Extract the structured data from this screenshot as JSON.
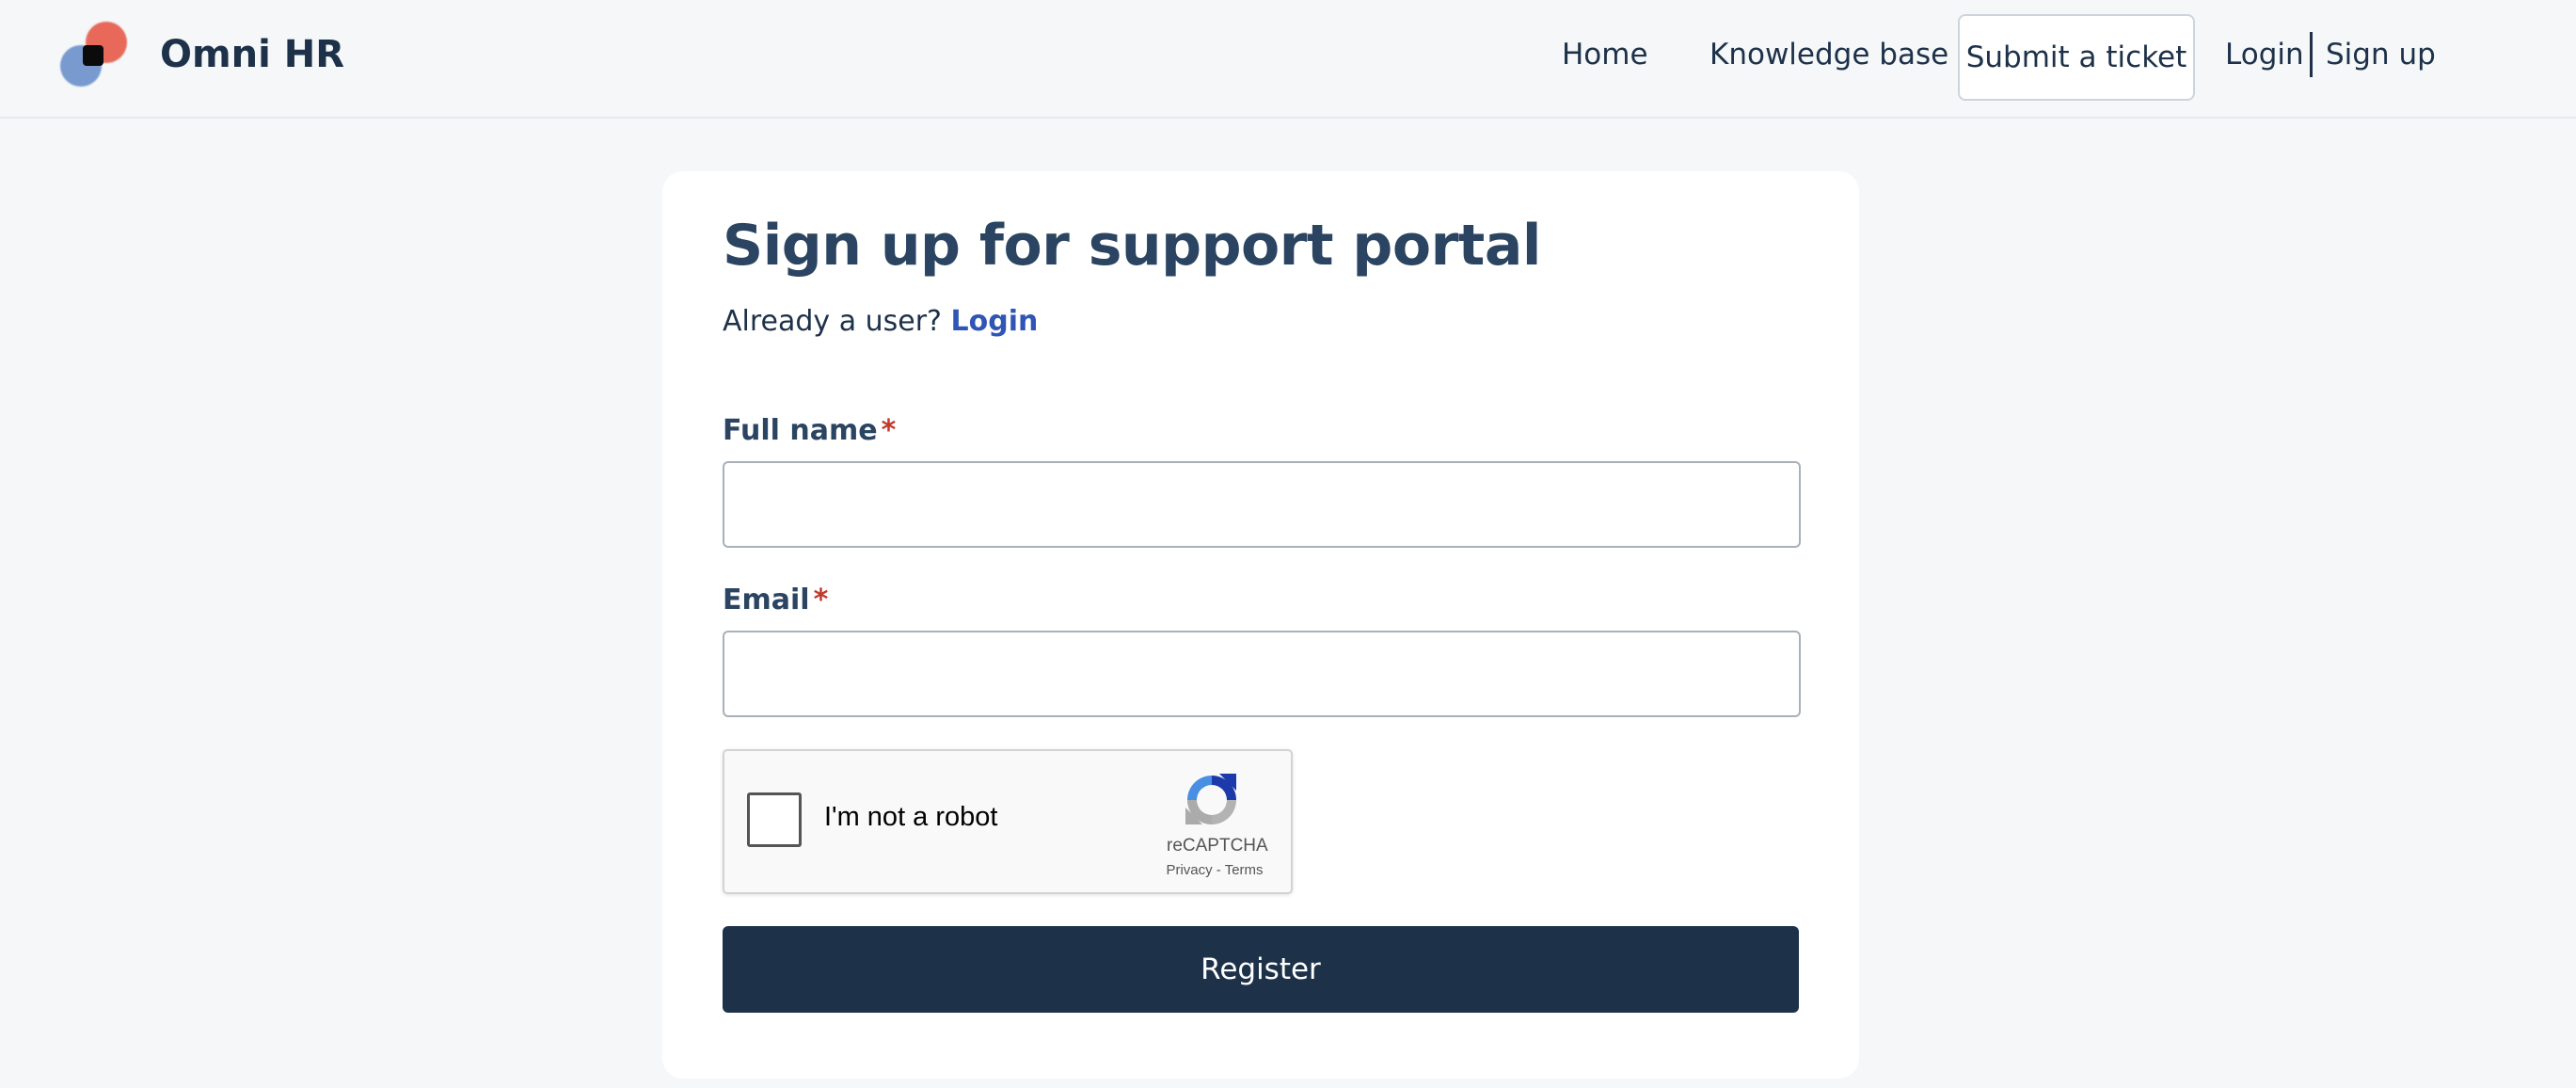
{
  "header": {
    "brand": "Omni HR",
    "nav": {
      "home": "Home",
      "knowledge_base": "Knowledge base",
      "submit_ticket": "Submit a ticket",
      "login": "Login",
      "signup": "Sign up"
    }
  },
  "form": {
    "title": "Sign up for support portal",
    "already_user": "Already a user?",
    "login_link": "Login",
    "full_name_label": "Full name",
    "email_label": "Email",
    "required_marker": "*",
    "full_name_value": "",
    "email_value": "",
    "register_label": "Register"
  },
  "captcha": {
    "label": "I'm not a robot",
    "brand": "reCAPTCHA",
    "privacy": "Privacy",
    "separator": "-",
    "terms": "Terms",
    "icon": "recaptcha-logo-icon"
  },
  "colors": {
    "primary": "#1d3149",
    "link": "#2f55b5",
    "required": "#c0392b",
    "background": "#f5f7f9"
  }
}
